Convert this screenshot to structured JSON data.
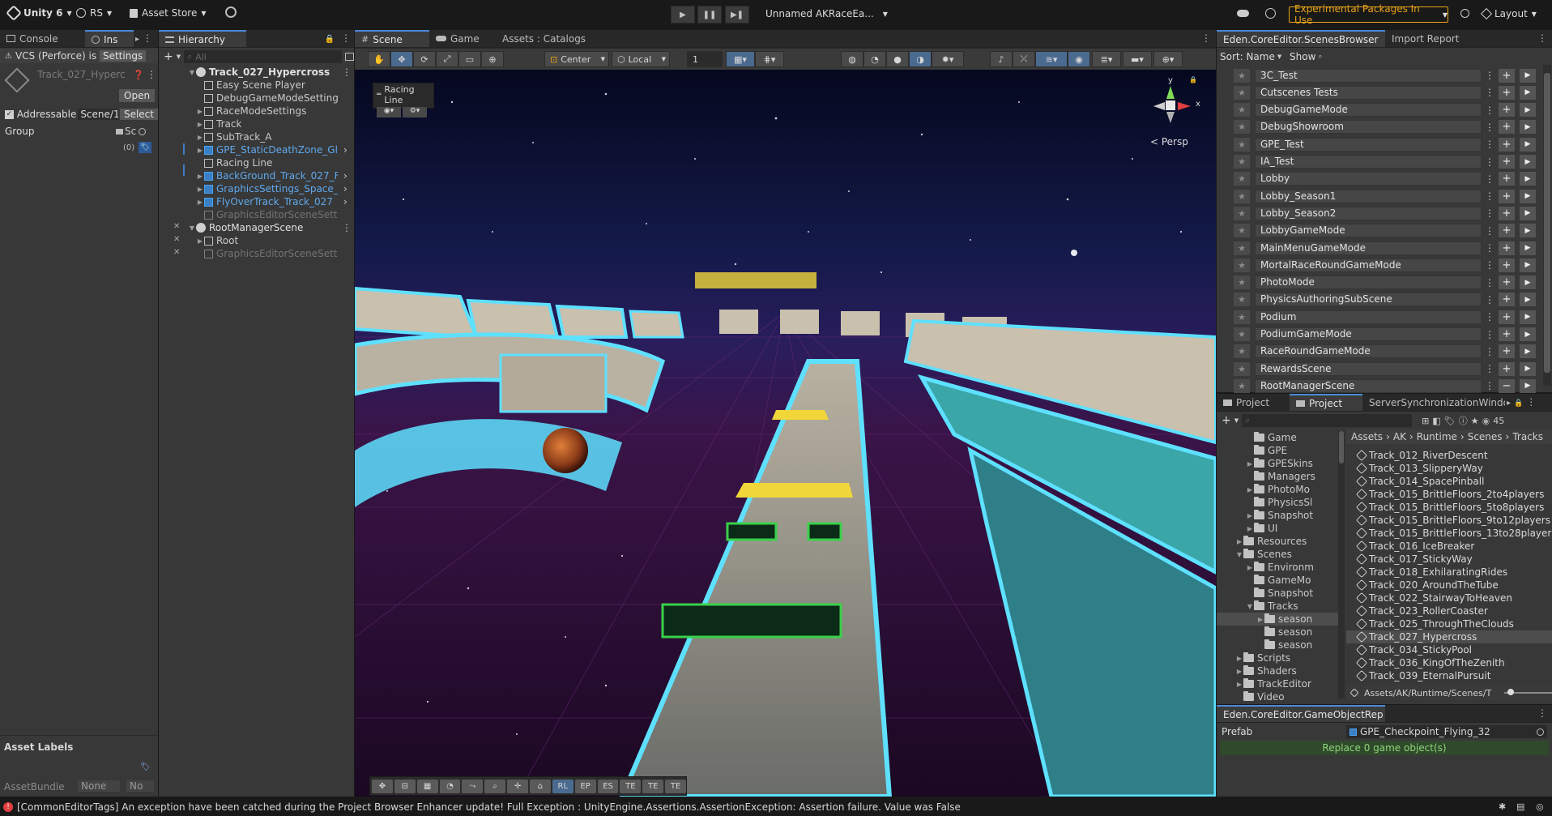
{
  "topbar": {
    "app": "Unity 6",
    "account": "RS",
    "asset_store": "Asset Store",
    "scene_name": "Unnamed AKRaceEa...",
    "experimental": "Experimental Packages In Use",
    "layout": "Layout"
  },
  "inspector": {
    "tab_console": "Console",
    "tab_inspector": "Ins",
    "vcs_text": "VCS (Perforce) is",
    "settings_btn": "Settings",
    "asset_name": "Track_027_Hyperc",
    "open_btn": "Open",
    "addressable_label": "Addressable",
    "addressable_value": "Scene/1",
    "select_btn": "Select",
    "group_label": "Group",
    "group_value": "Sc",
    "count_badge": "(0)",
    "asset_labels": "Asset Labels",
    "asset_bundle_label": "AssetBundle",
    "asset_bundle_value": "None",
    "asset_bundle_variant": "No"
  },
  "hierarchy": {
    "tab": "Hierarchy",
    "search_placeholder": "All",
    "rows": [
      {
        "label": "Track_027_Hypercross",
        "kind": "scene",
        "depth": 0,
        "bold": true,
        "color": "#e0e0e0"
      },
      {
        "label": "Easy Scene Player",
        "kind": "cube",
        "depth": 1,
        "color": "#c9c9c9"
      },
      {
        "label": "DebugGameModeSettings",
        "kind": "cube",
        "depth": 1,
        "color": "#c9c9c9"
      },
      {
        "label": "RaceModeSettings",
        "kind": "cube",
        "depth": 1,
        "arrow": true,
        "color": "#c9c9c9"
      },
      {
        "label": "Track",
        "kind": "cube",
        "depth": 1,
        "arrow": true,
        "color": "#c9c9c9"
      },
      {
        "label": "SubTrack_A",
        "kind": "cube",
        "depth": 1,
        "arrow": true,
        "color": "#c9c9c9"
      },
      {
        "label": "GPE_StaticDeathZone_Glc",
        "kind": "blue",
        "depth": 1,
        "arrow": true,
        "color": "#5fa8ec",
        "chev": true
      },
      {
        "label": "Racing Line",
        "kind": "cube",
        "depth": 1,
        "color": "#c9c9c9"
      },
      {
        "label": "BackGround_Track_027_F",
        "kind": "blue",
        "depth": 1,
        "arrow": true,
        "color": "#5fa8ec",
        "chev": true
      },
      {
        "label": "GraphicsSettings_Space_I",
        "kind": "blue",
        "depth": 1,
        "arrow": true,
        "color": "#5fa8ec",
        "chev": true
      },
      {
        "label": "FlyOverTrack_Track_027",
        "kind": "blue",
        "depth": 1,
        "arrow": true,
        "color": "#5fa8ec",
        "chev": true
      },
      {
        "label": "GraphicsEditorSceneSettin",
        "kind": "grey",
        "depth": 1,
        "color": "#737373"
      },
      {
        "label": "RootManagerScene",
        "kind": "scene",
        "depth": 0,
        "color": "#e0e0e0"
      },
      {
        "label": "Root",
        "kind": "cube",
        "depth": 1,
        "arrow": true,
        "color": "#c9c9c9"
      },
      {
        "label": "GraphicsEditorSceneSetting",
        "kind": "grey",
        "depth": 1,
        "color": "#737373"
      }
    ]
  },
  "scene_view": {
    "tabs": [
      "Scene",
      "Game",
      "Assets : Catalogs"
    ],
    "pivot": "Center",
    "space": "Local",
    "grid_value": "1",
    "overlay_title": "Racing Line",
    "persp_label": "< Persp",
    "axis_y": "y",
    "axis_x": "x",
    "bottom_tools": [
      "RL",
      "EP",
      "ES",
      "TE",
      "TE",
      "TE"
    ]
  },
  "scenes_browser": {
    "tab": "Eden.CoreEditor.ScenesBrowser",
    "tab2": "Import Report",
    "sort_label": "Sort: Name",
    "show_label": "Show",
    "scenes": [
      "3C_Test",
      "Cutscenes Tests",
      "DebugGameMode",
      "DebugShowroom",
      "GPE_Test",
      "IA_Test",
      "Lobby",
      "Lobby_Season1",
      "Lobby_Season2",
      "LobbyGameMode",
      "MainMenuGameMode",
      "MortalRaceRoundGameMode",
      "PhotoMode",
      "PhysicsAuthoringSubScene",
      "Podium",
      "PodiumGameMode",
      "RaceRoundGameMode",
      "RewardsScene",
      "RootManagerScene"
    ]
  },
  "project": {
    "tabs": [
      "Project",
      "Project",
      "ServerSynchronizationWindo"
    ],
    "count": "45",
    "breadcrumb": [
      "Assets",
      "AK",
      "Runtime",
      "Scenes",
      "Tracks"
    ],
    "tree": [
      {
        "label": "Game",
        "depth": 2,
        "arrow": false
      },
      {
        "label": "GPE",
        "depth": 2,
        "arrow": false
      },
      {
        "label": "GPESkins",
        "depth": 2,
        "arrow": true
      },
      {
        "label": "Managers",
        "depth": 2,
        "arrow": false
      },
      {
        "label": "PhotoMo",
        "depth": 2,
        "arrow": true
      },
      {
        "label": "PhysicsSl",
        "depth": 2,
        "arrow": false
      },
      {
        "label": "Snapshot",
        "depth": 2,
        "arrow": true
      },
      {
        "label": "UI",
        "depth": 2,
        "arrow": true
      },
      {
        "label": "Resources",
        "depth": 1,
        "arrow": true
      },
      {
        "label": "Scenes",
        "depth": 1,
        "arrow": true,
        "open": true
      },
      {
        "label": "Environm",
        "depth": 2,
        "arrow": true
      },
      {
        "label": "GameMo",
        "depth": 2,
        "arrow": false
      },
      {
        "label": "Snapshot",
        "depth": 2,
        "arrow": false
      },
      {
        "label": "Tracks",
        "depth": 2,
        "arrow": true,
        "open": true
      },
      {
        "label": "season",
        "depth": 3,
        "arrow": true,
        "selected": true
      },
      {
        "label": "season",
        "depth": 3,
        "arrow": false
      },
      {
        "label": "season",
        "depth": 3,
        "arrow": false
      },
      {
        "label": "Scripts",
        "depth": 1,
        "arrow": true
      },
      {
        "label": "Shaders",
        "depth": 1,
        "arrow": true
      },
      {
        "label": "TrackEditor",
        "depth": 1,
        "arrow": true
      },
      {
        "label": "Video",
        "depth": 1,
        "arrow": false
      }
    ],
    "files": [
      "Track_012_RiverDescent",
      "Track_013_SlipperyWay",
      "Track_014_SpacePinball",
      "Track_015_BrittleFloors_2to4players",
      "Track_015_BrittleFloors_5to8players",
      "Track_015_BrittleFloors_9to12players",
      "Track_015_BrittleFloors_13to28player",
      "Track_016_IceBreaker",
      "Track_017_StickyWay",
      "Track_018_ExhilaratingRides",
      "Track_020_AroundTheTube",
      "Track_022_StairwayToHeaven",
      "Track_023_RollerCoaster",
      "Track_025_ThroughTheClouds",
      "Track_027_Hypercross",
      "Track_034_StickyPool",
      "Track_036_KingOfTheZenith",
      "Track_039_EternalPursuit"
    ],
    "selected_file": "Track_027_Hypercross",
    "path": "Assets/AK/Runtime/Scenes/T"
  },
  "gameobject_replacer": {
    "tab": "Eden.CoreEditor.GameObjectRep",
    "prefab_label": "Prefab",
    "prefab_value": "GPE_Checkpoint_Flying_32",
    "replace_btn": "Replace 0 game object(s)"
  },
  "statusbar": {
    "message": "[CommonEditorTags] An exception have been catched during the Project Browser Enhancer update! Full Exception : UnityEngine.Assertions.AssertionException: Assertion failure. Value was False"
  },
  "colors": {
    "accent": "#4a8ad8",
    "warning": "#e8a317",
    "prefab_blue": "#5fa8ec",
    "error": "#e04040"
  }
}
